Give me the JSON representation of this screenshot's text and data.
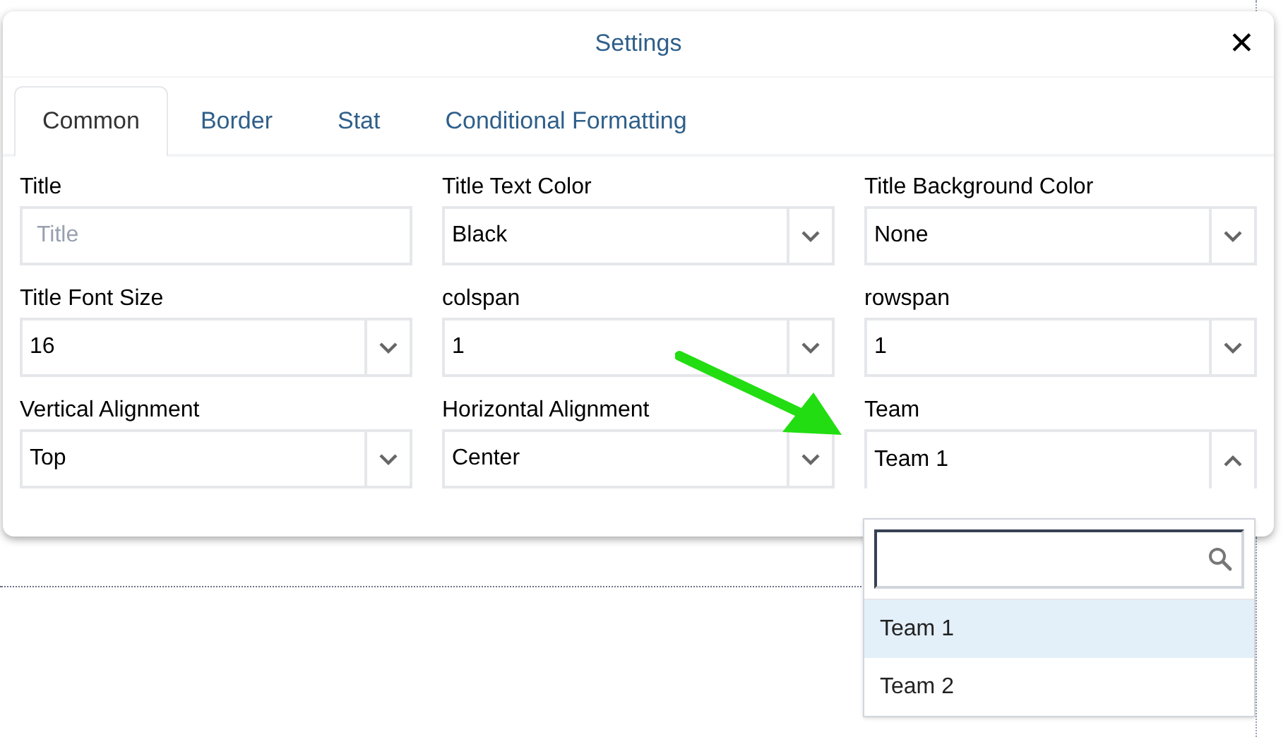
{
  "dialog": {
    "title": "Settings",
    "close": "✕"
  },
  "tabs": [
    {
      "label": "Common",
      "selected": true
    },
    {
      "label": "Border",
      "selected": false
    },
    {
      "label": "Stat",
      "selected": false
    },
    {
      "label": "Conditional Formatting",
      "selected": false
    }
  ],
  "fields": [
    {
      "kind": "text",
      "label": "Title",
      "placeholder": "Title"
    },
    {
      "kind": "select",
      "label": "Title Text Color",
      "value": "Black",
      "expanded": false
    },
    {
      "kind": "select",
      "label": "Title Background Color",
      "value": "None",
      "expanded": false
    },
    {
      "kind": "select",
      "label": "Title Font Size",
      "value": "16",
      "expanded": false
    },
    {
      "kind": "select",
      "label": "colspan",
      "value": "1",
      "expanded": false
    },
    {
      "kind": "select",
      "label": "rowspan",
      "value": "1",
      "expanded": false
    },
    {
      "kind": "select",
      "label": "Vertical Alignment",
      "value": "Top",
      "expanded": false
    },
    {
      "kind": "select",
      "label": "Horizontal Alignment",
      "value": "Center",
      "expanded": false
    },
    {
      "kind": "select",
      "label": "Team",
      "value": "Team 1",
      "expanded": true
    }
  ],
  "dropdown": {
    "options": [
      {
        "label": "Team 1",
        "selected": true
      },
      {
        "label": "Team 2",
        "selected": false
      }
    ]
  }
}
